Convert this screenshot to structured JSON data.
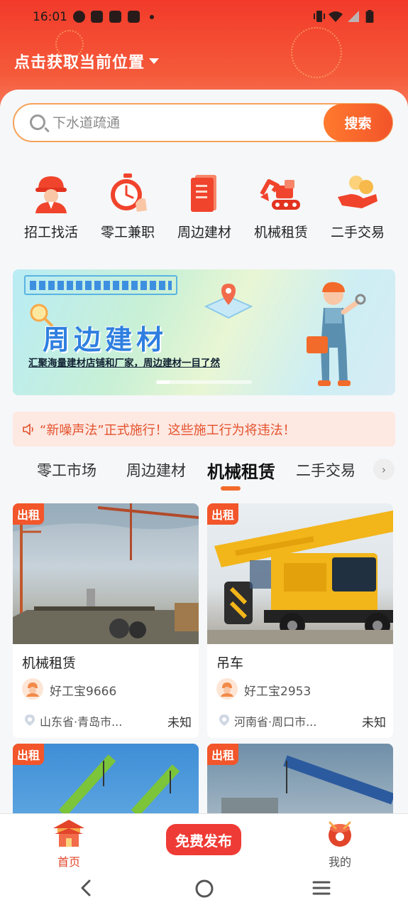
{
  "status_bar": {
    "time": "16:01"
  },
  "header": {
    "location_label": "点击获取当前位置"
  },
  "search": {
    "placeholder": "下水道疏通",
    "button_label": "搜索"
  },
  "categories": [
    {
      "label": "招工找活",
      "icon": "worker-helmet-icon"
    },
    {
      "label": "零工兼职",
      "icon": "stopwatch-icon"
    },
    {
      "label": "周边建材",
      "icon": "document-book-icon"
    },
    {
      "label": "机械租赁",
      "icon": "excavator-icon"
    },
    {
      "label": "二手交易",
      "icon": "coins-hand-icon"
    }
  ],
  "banner": {
    "title": "周边建材",
    "subtitle": "汇聚海量建材店铺和厂家，周边建材一目了然"
  },
  "notice": {
    "text": "“新噪声法”正式施行！这些施工行为将违法！"
  },
  "tabs": [
    {
      "label": "零工市场",
      "active": false
    },
    {
      "label": "周边建材",
      "active": false
    },
    {
      "label": "机械租赁",
      "active": true
    },
    {
      "label": "二手交易",
      "active": false
    }
  ],
  "listings": [
    {
      "badge": "出租",
      "title": "机械租赁",
      "user": "好工宝9666",
      "location": "山东省·青岛市...",
      "price": "未知",
      "image": "construction-site-cranes"
    },
    {
      "badge": "出租",
      "title": "吊车",
      "user": "好工宝2953",
      "location": "河南省·周口市...",
      "price": "未知",
      "image": "yellow-crane-truck"
    },
    {
      "badge": "出租",
      "title": "",
      "user": "",
      "location": "",
      "price": "",
      "image": "green-tower-cranes"
    },
    {
      "badge": "出租",
      "title": "",
      "user": "",
      "location": "",
      "price": "",
      "image": "blue-crane-boom"
    }
  ],
  "bottom_nav": {
    "home_label": "首页",
    "publish_label": "免费发布",
    "me_label": "我的"
  },
  "colors": {
    "primary": "#f2542a",
    "header_red": "#f23a2a",
    "search_border": "#f5a35a",
    "publish": "#ef3b35"
  }
}
